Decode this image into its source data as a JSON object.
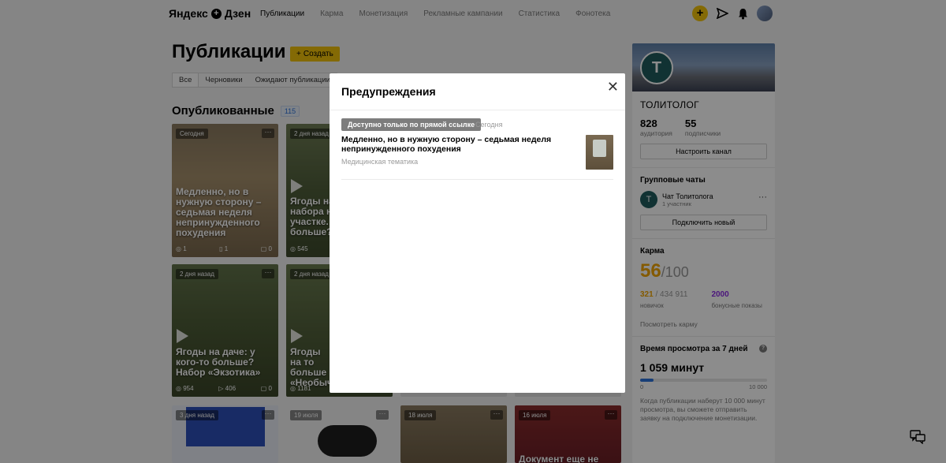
{
  "header": {
    "logo_text": "Яндекс",
    "logo_glyph": "+",
    "logo_suffix": "Дзен",
    "nav": [
      "Публикации",
      "Карма",
      "Монетизация",
      "Рекламные кампании",
      "Статистика",
      "Фонотека"
    ],
    "plus_glyph": "+"
  },
  "page": {
    "title": "Публикации",
    "create_glyph": "+",
    "create_label": "Создать",
    "tabs": [
      "Все",
      "Черновики",
      "Ожидают публикации"
    ],
    "section_title": "Опубликованные",
    "count": "115"
  },
  "cards": [
    {
      "date": "Сегодня",
      "title": "Медленно, но в нужную сторону – седьмая неделя непринужденного похудения",
      "stats": [
        "1",
        "1",
        "0"
      ]
    },
    {
      "date": "2 дня назад",
      "title": "Ягоды на набора на участке. У больше?",
      "stats": [
        "545"
      ]
    },
    {
      "date": "2 дня назад",
      "title": "Ягоды на даче: у кого-то больше? Набор «Экзотика»",
      "stats": [
        "954",
        "406",
        "0"
      ]
    },
    {
      "date": "2 дня назад",
      "title": "Ягоды на то больше «Необычн",
      "stats": [
        "1181"
      ]
    },
    {
      "date": "3 дня назад",
      "title": "",
      "stats": []
    },
    {
      "date": "19 июля",
      "title": "",
      "stats": []
    },
    {
      "date": "18 июля",
      "title": "",
      "stats": []
    },
    {
      "date": "16 июля",
      "title": "Документ еще не",
      "stats": []
    }
  ],
  "more_glyph": "···",
  "channel": {
    "logo_text": "Т",
    "name": "ТОЛИТОЛОГ",
    "audience": "828",
    "audience_label": "аудитория",
    "subscribers": "55",
    "subscribers_label": "подписчики",
    "settings_btn": "Настроить канал",
    "group_chats_title": "Групповые чаты",
    "chat_name": "Чат Толитолога",
    "chat_members": "1 участник",
    "more_glyph": "···",
    "connect_btn": "Подключить новый",
    "karma_title": "Карма",
    "karma_value": "56",
    "karma_max": "/100",
    "karma_rank": "321",
    "karma_rank_total": " / 434 911",
    "karma_rank_label": "новичок",
    "bonus": "2000",
    "bonus_label": "бонусные показы",
    "karma_link": "Посмотреть карму",
    "watch_title": "Время просмотра за 7 дней",
    "help_glyph": "?",
    "watch_value": "1 059 минут",
    "watch_progress": 0.1059,
    "progress_min": "0",
    "progress_max": "10 000",
    "note": "Когда публикации наберут 10 000 минут просмотра, вы сможете отправить заявку на подключение монетизации."
  },
  "modal": {
    "title": "Предупреждения",
    "close_glyph": "✕",
    "badge": "Доступно только по прямой ссылке",
    "date": "Сегодня",
    "item_title": "Медленно, но в нужную сторону – седьмая неделя непринужденного похудения",
    "category": "Медицинская тематика"
  },
  "colors": {
    "accent": "#f0c20a",
    "karma": "#f0a400",
    "bonus": "#8a2be2",
    "link_blue": "#2d72d9"
  }
}
